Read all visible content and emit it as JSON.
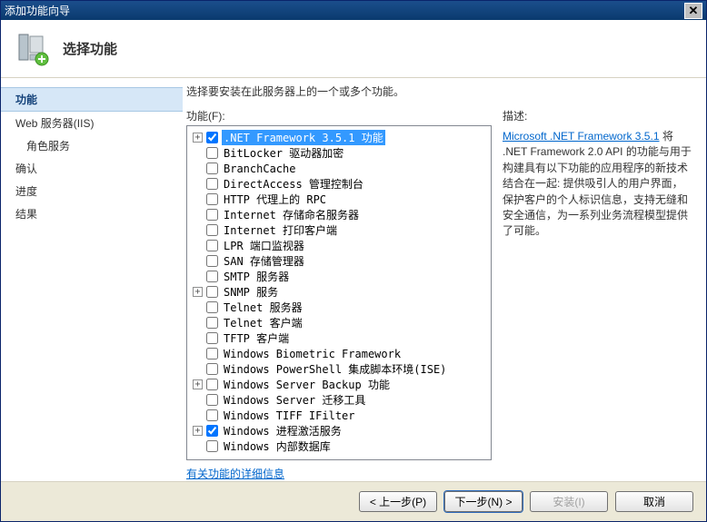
{
  "window": {
    "title": "添加功能向导"
  },
  "header": {
    "heading": "选择功能"
  },
  "sidebar": {
    "items": [
      {
        "label": "功能",
        "active": true,
        "sub": false
      },
      {
        "label": "Web 服务器(IIS)",
        "active": false,
        "sub": false
      },
      {
        "label": "角色服务",
        "active": false,
        "sub": true
      },
      {
        "label": "确认",
        "active": false,
        "sub": false
      },
      {
        "label": "进度",
        "active": false,
        "sub": false
      },
      {
        "label": "结果",
        "active": false,
        "sub": false
      }
    ]
  },
  "main": {
    "instruction": "选择要安装在此服务器上的一个或多个功能。",
    "features_label": "功能(F):",
    "features": [
      {
        "label": ".NET Framework 3.5.1 功能",
        "checked": true,
        "expandable": true,
        "selected": true
      },
      {
        "label": "BitLocker 驱动器加密",
        "checked": false,
        "expandable": false
      },
      {
        "label": "BranchCache",
        "checked": false,
        "expandable": false
      },
      {
        "label": "DirectAccess 管理控制台",
        "checked": false,
        "expandable": false
      },
      {
        "label": "HTTP 代理上的 RPC",
        "checked": false,
        "expandable": false
      },
      {
        "label": "Internet 存储命名服务器",
        "checked": false,
        "expandable": false
      },
      {
        "label": "Internet 打印客户端",
        "checked": false,
        "expandable": false
      },
      {
        "label": "LPR 端口监视器",
        "checked": false,
        "expandable": false
      },
      {
        "label": "SAN 存储管理器",
        "checked": false,
        "expandable": false
      },
      {
        "label": "SMTP 服务器",
        "checked": false,
        "expandable": false
      },
      {
        "label": "SNMP 服务",
        "checked": false,
        "expandable": true
      },
      {
        "label": "Telnet 服务器",
        "checked": false,
        "expandable": false
      },
      {
        "label": "Telnet 客户端",
        "checked": false,
        "expandable": false
      },
      {
        "label": "TFTP 客户端",
        "checked": false,
        "expandable": false
      },
      {
        "label": "Windows Biometric Framework",
        "checked": false,
        "expandable": false
      },
      {
        "label": "Windows PowerShell 集成脚本环境(ISE)",
        "checked": false,
        "expandable": false
      },
      {
        "label": "Windows Server Backup 功能",
        "checked": false,
        "expandable": true
      },
      {
        "label": "Windows Server 迁移工具",
        "checked": false,
        "expandable": false
      },
      {
        "label": "Windows TIFF IFilter",
        "checked": false,
        "expandable": false
      },
      {
        "label": "Windows 进程激活服务",
        "checked": true,
        "expandable": true
      },
      {
        "label": "Windows 内部数据库",
        "checked": false,
        "expandable": false
      }
    ],
    "more_link": "有关功能的详细信息",
    "desc_label": "描述:",
    "desc_link": "Microsoft .NET Framework 3.5.1",
    "desc_body": "将 .NET Framework 2.0 API 的功能与用于构建具有以下功能的应用程序的新技术结合在一起: 提供吸引人的用户界面，保护客户的个人标识信息，支持无缝和安全通信，为一系列业务流程模型提供了可能。"
  },
  "footer": {
    "prev": "< 上一步(P)",
    "next": "下一步(N) >",
    "install": "安装(I)",
    "cancel": "取消"
  }
}
